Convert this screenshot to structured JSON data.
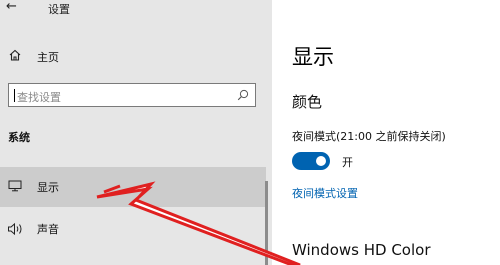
{
  "window": {
    "title": "设置",
    "back_icon": "back-arrow-icon"
  },
  "sidebar": {
    "home": {
      "label": "主页",
      "icon": "home-icon"
    },
    "search": {
      "placeholder": "查找设置",
      "icon": "search-icon"
    },
    "section_header": "系统",
    "items": [
      {
        "label": "显示",
        "icon": "monitor-icon",
        "selected": true
      },
      {
        "label": "声音",
        "icon": "speaker-icon",
        "selected": false
      }
    ]
  },
  "main": {
    "page_title": "显示",
    "color_heading": "颜色",
    "night_light_label": "夜间模式(21:00 之前保持关闭)",
    "toggle_state": "开",
    "toggle_on": true,
    "night_light_link": "夜间模式设置",
    "hd_color_heading": "Windows HD Color"
  },
  "colors": {
    "accent": "#0063b1",
    "sidebar_bg": "#e6e6e6",
    "selected_bg": "#cccccc",
    "annotation_arrow": "#e02020"
  }
}
